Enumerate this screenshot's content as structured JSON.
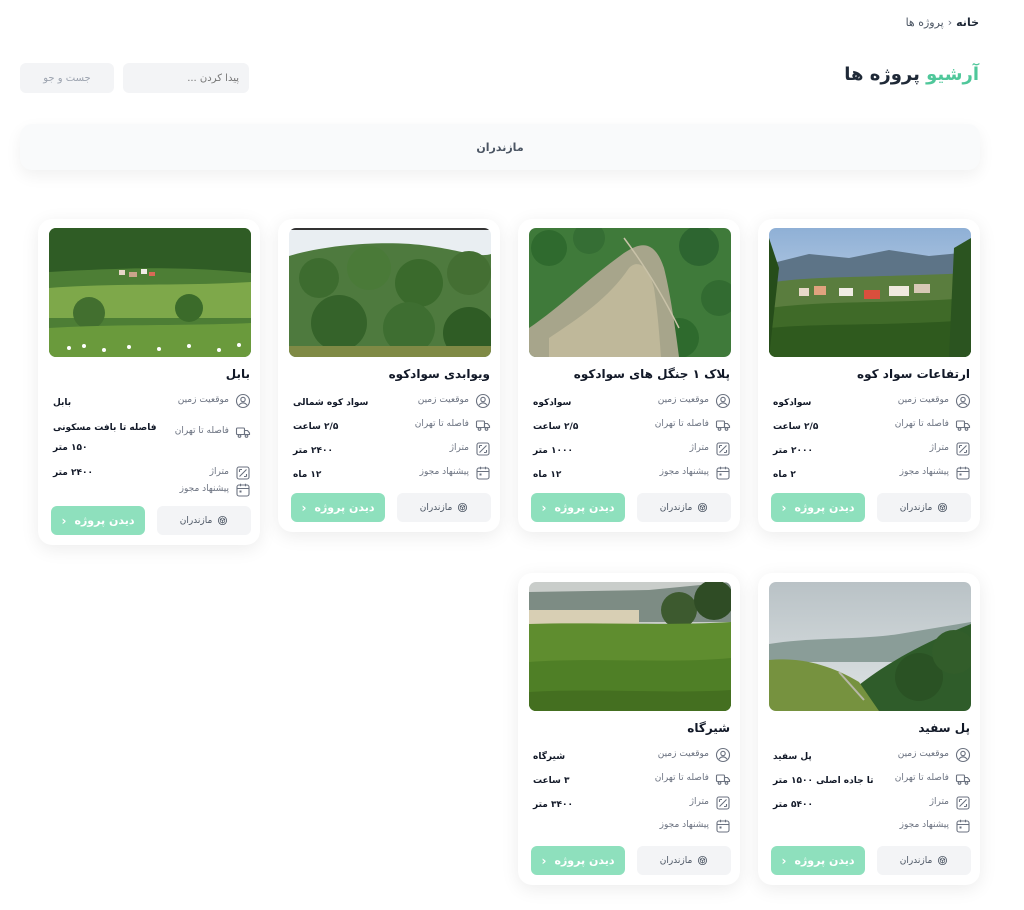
{
  "breadcrumb": {
    "home": "خانه",
    "separator": "›",
    "current": "پروژه ها"
  },
  "header": {
    "title_accent": "آرشیو",
    "title_rest": " پروژه ها"
  },
  "search": {
    "placeholder": "پیدا کردن ...",
    "button": "جست و جو"
  },
  "region_filter": {
    "label": "مازندران"
  },
  "labels": {
    "location": "موقعیت زمین",
    "distance": "فاصله تا تهران",
    "area": "متراژ",
    "permit": "پیشنهاد مجوز",
    "region": "مازندران",
    "view": "دیدن پروژه"
  },
  "projects": [
    {
      "title": "ارتفاعات سواد کوه",
      "location": "سوادکوه",
      "distance": "۲/۵ ساعت",
      "area": "۲۰۰۰ متر",
      "permit": "۲ ماه"
    },
    {
      "title": "پلاک ۱ جنگل های سوادکوه",
      "location": "سوادکوه",
      "distance": "۲/۵ ساعت",
      "area": "۱۰۰۰ متر",
      "permit": "۱۲ ماه"
    },
    {
      "title": "ویوابدی سوادکوه",
      "location": "سواد کوه شمالی",
      "distance": "۲/۵ ساعت",
      "area": "۲۴۰۰ متر",
      "permit": "۱۲ ماه"
    },
    {
      "title": "بابل",
      "location": "بابل",
      "distance": "فاصله تا بافت مسکونی",
      "distance2": "۱۵۰ متر",
      "area": "۲۴۰۰ متر",
      "permit": ""
    },
    {
      "title": "پل سفید",
      "location": "پل سفید",
      "distance": "تا جاده اصلی ۱۵۰۰ متر",
      "area": "۵۴۰۰ متر",
      "permit": ""
    },
    {
      "title": "شیرگاه",
      "location": "شیرگاه",
      "distance": "۳ ساعت",
      "area": "۳۴۰۰ متر",
      "permit": ""
    }
  ],
  "colors": {
    "accent": "#4fc79a",
    "button": "#8ee0bd",
    "chip": "#f3f4f6"
  },
  "icons": [
    "user-circle-icon",
    "truck-icon",
    "area-icon",
    "calendar-icon",
    "cube-icon",
    "chevron-left-icon"
  ]
}
